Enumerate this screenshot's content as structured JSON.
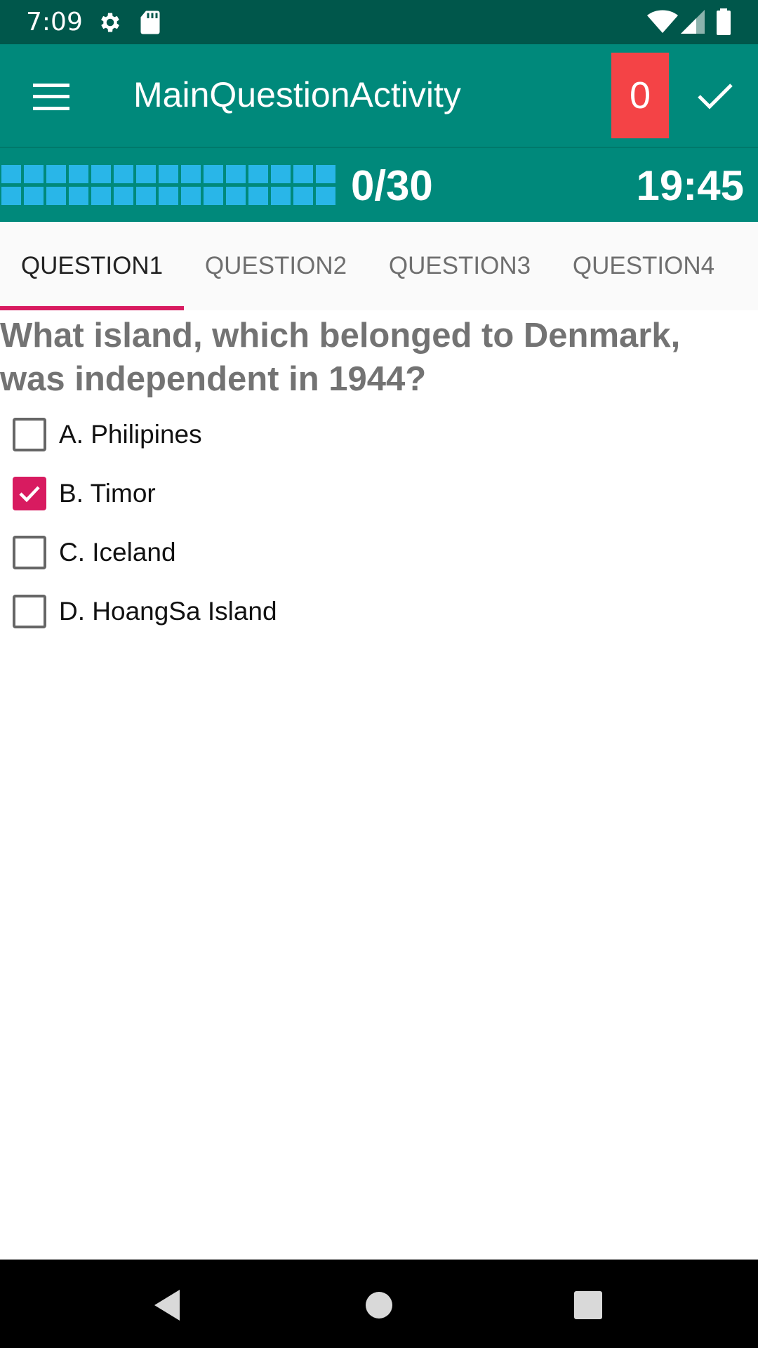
{
  "status_bar": {
    "time": "7:09",
    "icons": [
      "gear-icon",
      "sd-card-icon",
      "wifi-icon",
      "signal-icon",
      "battery-icon"
    ]
  },
  "toolbar": {
    "title": "MainQuestionActivity",
    "score": "0",
    "menu_icon": "hamburger-menu-icon",
    "submit_icon": "checkmark-icon",
    "colors": {
      "primary": "#00897b",
      "primary_dark": "#00574b",
      "badge": "#f44346"
    }
  },
  "progress": {
    "answered_fraction": 0.0,
    "count_text": "0/30",
    "timer": "19:45",
    "cell_color": "#29b6e8"
  },
  "tabs": [
    {
      "label": "QUESTION1",
      "active": true
    },
    {
      "label": "QUESTION2",
      "active": false
    },
    {
      "label": "QUESTION3",
      "active": false
    },
    {
      "label": "QUESTION4",
      "active": false
    }
  ],
  "question": {
    "text": "What island, which belonged to Denmark, was independent in 1944?",
    "options": [
      {
        "label": "A. Philipines",
        "checked": false
      },
      {
        "label": "B. Timor",
        "checked": true
      },
      {
        "label": "C. Iceland",
        "checked": false
      },
      {
        "label": "D. HoangSa Island",
        "checked": false
      }
    ],
    "accent_color": "#d81b60"
  },
  "nav_bar": {
    "buttons": [
      "back-icon",
      "home-icon",
      "recents-icon"
    ]
  }
}
